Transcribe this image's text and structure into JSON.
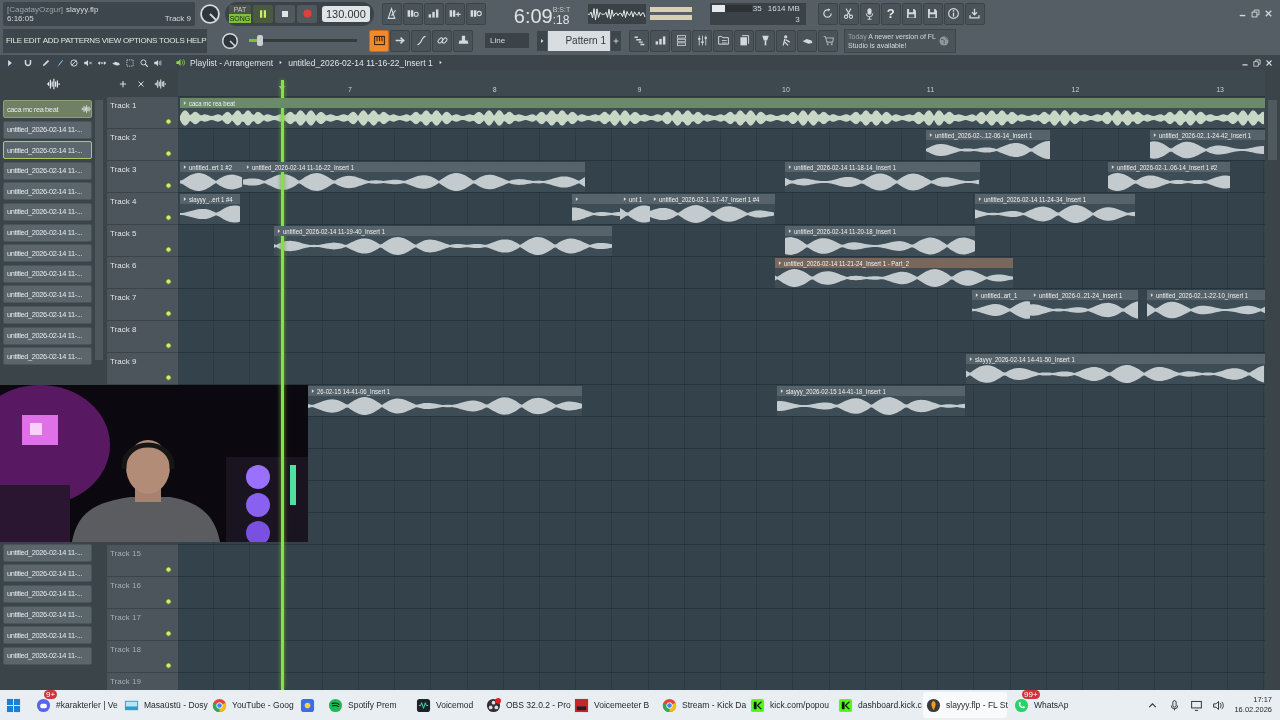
{
  "toolbar": {
    "project": {
      "user": "[CagatayOzgur]",
      "file": "slayyy.flp",
      "time": "6:16:05",
      "track": "Track 9"
    },
    "modes": [
      {
        "label": "PAT",
        "selected": false
      },
      {
        "label": "SONG",
        "selected": true
      }
    ],
    "playing": true,
    "tempo": "130.000",
    "clock": {
      "time": "6:09",
      "seconds": ":18",
      "format": "B:S:T"
    },
    "cpu": {
      "percent": "35",
      "memory": "1614 MB",
      "polyphony": "3",
      "level": 0.33
    },
    "help": "?",
    "menu": [
      "FILE",
      "EDIT",
      "ADD",
      "PATTERNS",
      "VIEW",
      "OPTIONS",
      "TOOLS",
      "HELP"
    ],
    "master_slider": {
      "level": 0.1
    },
    "snap": "Line",
    "pattern": "Pattern 1",
    "news": {
      "date": "Today",
      "message": "A newer version of FL Studio is available!"
    }
  },
  "playlist": {
    "title": "Playlist - Arrangement",
    "breadcrumb": "untitled_2026-02-14 11-16-22_Insert 1",
    "bar_numbers": [
      "7",
      "8",
      "9",
      "10",
      "11",
      "12",
      "13"
    ],
    "clip_list": {
      "above_camera": [
        {
          "label": "caca mc rea beat",
          "selected": true,
          "focused": false
        },
        {
          "label": "untitled_2026-02-14 11-...",
          "selected": false,
          "focused": false
        },
        {
          "label": "untitled_2026-02-14 11-...",
          "selected": false,
          "focused": true
        },
        {
          "label": "untitled_2026-02-14 11-...",
          "selected": false,
          "focused": false
        },
        {
          "label": "untitled_2026-02-14 11-...",
          "selected": false,
          "focused": false
        },
        {
          "label": "untitled_2026-02-14 11-...",
          "selected": false,
          "focused": false
        },
        {
          "label": "untitled_2026-02-14 11-...",
          "selected": false,
          "focused": false
        },
        {
          "label": "untitled_2026-02-14 11-...",
          "selected": false,
          "focused": false
        },
        {
          "label": "untitled_2026-02-14 11-...",
          "selected": false,
          "focused": false
        },
        {
          "label": "untitled_2026-02-14 11-...",
          "selected": false,
          "focused": false
        },
        {
          "label": "untitled_2026-02-14 11-...",
          "selected": false,
          "focused": false
        },
        {
          "label": "untitled_2026-02-14 11-...",
          "selected": false,
          "focused": false
        },
        {
          "label": "untitled_2026-02-14 11-...",
          "selected": false,
          "focused": false
        }
      ],
      "below_camera": [
        {
          "label": "untitled_2026-02-14 11-...",
          "selected": false,
          "focused": false
        },
        {
          "label": "untitled_2026-02-14 11-...",
          "selected": false,
          "focused": false
        },
        {
          "label": "untitled_2026-02-14 11-...",
          "selected": false,
          "focused": false
        },
        {
          "label": "untitled_2026-02-14 11-...",
          "selected": false,
          "focused": false
        },
        {
          "label": "untitled_2026-02-14 11-...",
          "selected": false,
          "focused": false
        },
        {
          "label": "untitled_2026-02-14 11-...",
          "selected": false,
          "focused": false
        }
      ]
    },
    "lanes": [
      {
        "label": "Track 1",
        "dimmed": false,
        "clips": [
          {
            "name": "caca mc rea beat",
            "color": "#6a8a68"
          }
        ]
      },
      {
        "label": "Track 2",
        "dimmed": false,
        "clips": [
          {
            "name": "untitled_2026-02-..12-06-14_Insert 1",
            "color": "#56636b"
          },
          {
            "name": "untitled_2026-02..1-24-42_Insert 1",
            "color": "#56636b"
          }
        ]
      },
      {
        "label": "Track 3",
        "dimmed": false,
        "clips": [
          {
            "name": "untitled..ert 1 #2",
            "color": "#56636b"
          },
          {
            "name": "untitled_2026-02-14 11-16-22_Insert 1",
            "color": "#56636b"
          },
          {
            "name": "untitled_2026-02-14 11-18-14_Insert 1",
            "color": "#56636b"
          },
          {
            "name": "untitled_2026-02-1..06-14_Insert 1 #2",
            "color": "#56636b"
          }
        ]
      },
      {
        "label": "Track 4",
        "dimmed": false,
        "clips": [
          {
            "name": "slayyy_..ert 1 #4",
            "color": "#56636b"
          },
          {
            "color": "#56636b"
          },
          {
            "name": "unt 1",
            "color": "#56636b"
          },
          {
            "name": "untitled_2026-02-1..17-47_Insert 1 #4",
            "color": "#56636b"
          },
          {
            "name": "untitled_2026-02-14 11-24-34_Insert 1",
            "color": "#56636b"
          }
        ]
      },
      {
        "label": "Track 5",
        "dimmed": false,
        "clips": [
          {
            "name": "untitled_2026-02-14 11-19-40_Insert 1",
            "color": "#56636b"
          },
          {
            "name": "untitled_2026-02-14 11-20-18_Insert 1",
            "color": "#56636b"
          }
        ]
      },
      {
        "label": "Track 6",
        "dimmed": false,
        "clips": [
          {
            "name": "untitled_2026-02-14 11-21-24_Insert 1 - Part_2",
            "color": "#7a675c"
          }
        ]
      },
      {
        "label": "Track 7",
        "dimmed": false,
        "clips": [
          {
            "name": "untitled..art_1",
            "color": "#56636b"
          },
          {
            "name": "untitled_2026-0..21-24_Insert 1",
            "color": "#56636b"
          },
          {
            "name": "untitled_2026-02..1-22-10_Insert 1",
            "color": "#56636b"
          }
        ]
      },
      {
        "label": "Track 8",
        "dimmed": false
      },
      {
        "label": "Track 9",
        "dimmed": false,
        "clips": [
          {
            "name": "slayyy_2026-02-14 14-41-50_Insert 1",
            "color": "#56636b"
          }
        ]
      },
      {
        "clips": [
          {
            "name": "26-02-15 14-41-06_Insert 1",
            "color": "#56636b"
          },
          {
            "name": "slayyy_2026-02-15 14-41-18_Insert 1",
            "color": "#56636b"
          }
        ]
      }
    ],
    "lower_lanes": [
      {
        "label": "Track 15",
        "dimmed": true
      },
      {
        "label": "Track 16",
        "dimmed": true
      },
      {
        "label": "Track 17",
        "dimmed": true
      },
      {
        "label": "Track 18",
        "dimmed": true
      },
      {
        "label": "Track 19",
        "dimmed": true
      }
    ]
  },
  "taskbar": {
    "apps": [
      {
        "label": "#karakterler | Ve",
        "badge": "9+",
        "active": false
      },
      {
        "label": "Masaüstü - Dosy",
        "active": false
      },
      {
        "label": "YouTube - Goog",
        "active": false
      },
      {
        "active": false
      },
      {
        "label": "Spotify Prem",
        "active": false
      },
      {
        "label": "Voicemod",
        "active": false
      },
      {
        "label": "OBS 32.0.2 - Pro",
        "active": false
      },
      {
        "label": "Voicemeeter B",
        "active": false
      },
      {
        "label": "Stream - Kick Da",
        "active": false
      },
      {
        "label": "kick.com/popou",
        "active": false
      },
      {
        "label": "dashboard.kick.c",
        "active": false
      },
      {
        "label": "slayyy.flp - FL St",
        "active": true
      },
      {
        "label": "WhatsAp",
        "badge": "99+",
        "active": false
      }
    ],
    "time": "17:17",
    "date": "16.02.2026"
  }
}
